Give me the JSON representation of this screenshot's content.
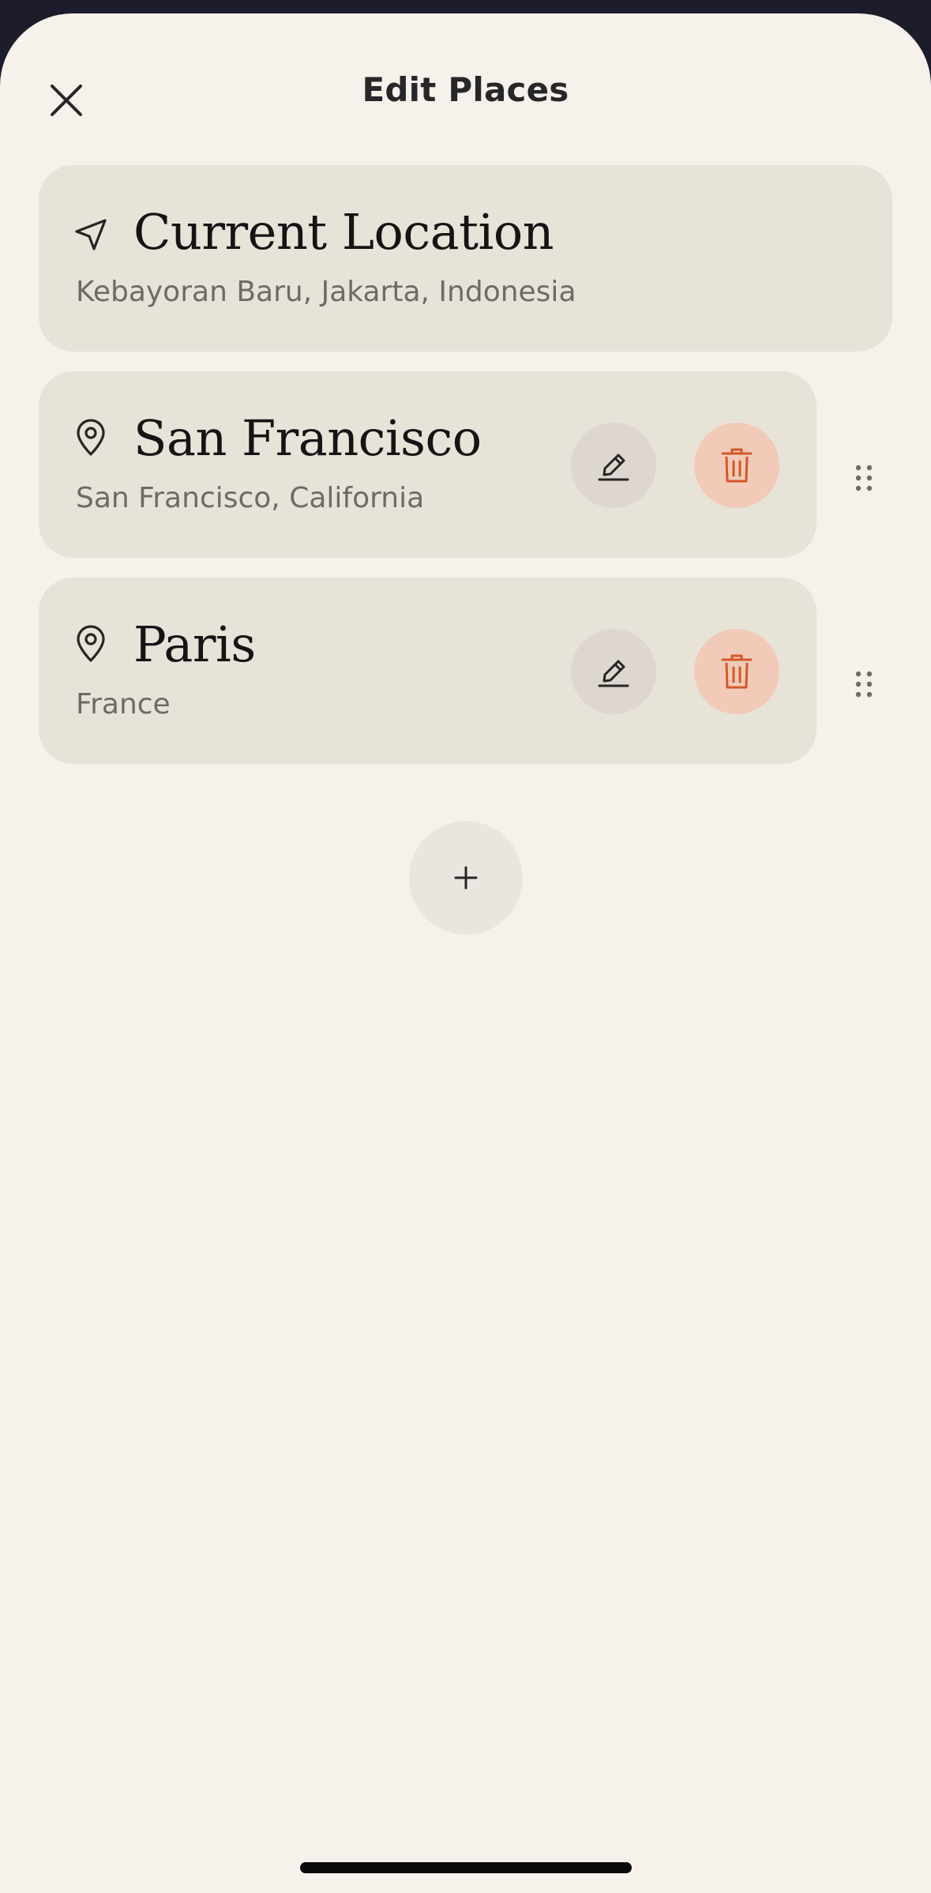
{
  "header": {
    "title": "Edit Places"
  },
  "places": [
    {
      "name": "Current Location",
      "subtitle": "Kebayoran Baru, Jakarta, Indonesia",
      "icon": "navigation-arrow-icon"
    },
    {
      "name": "San Francisco",
      "subtitle": "San Francisco, California",
      "icon": "map-pin-icon"
    },
    {
      "name": "Paris",
      "subtitle": "France",
      "icon": "map-pin-icon"
    }
  ],
  "icons": {
    "close": "close-icon",
    "edit": "pencil-icon",
    "delete": "trash-icon",
    "drag": "drag-handle-icon",
    "add": "plus-icon"
  },
  "colors": {
    "sheet_background": "#f6f1eb",
    "card_background": "#e7e3d9",
    "delete_accent": "#d4582a",
    "delete_background": "#f1cbb8",
    "edit_background": "#ddd7d0"
  }
}
